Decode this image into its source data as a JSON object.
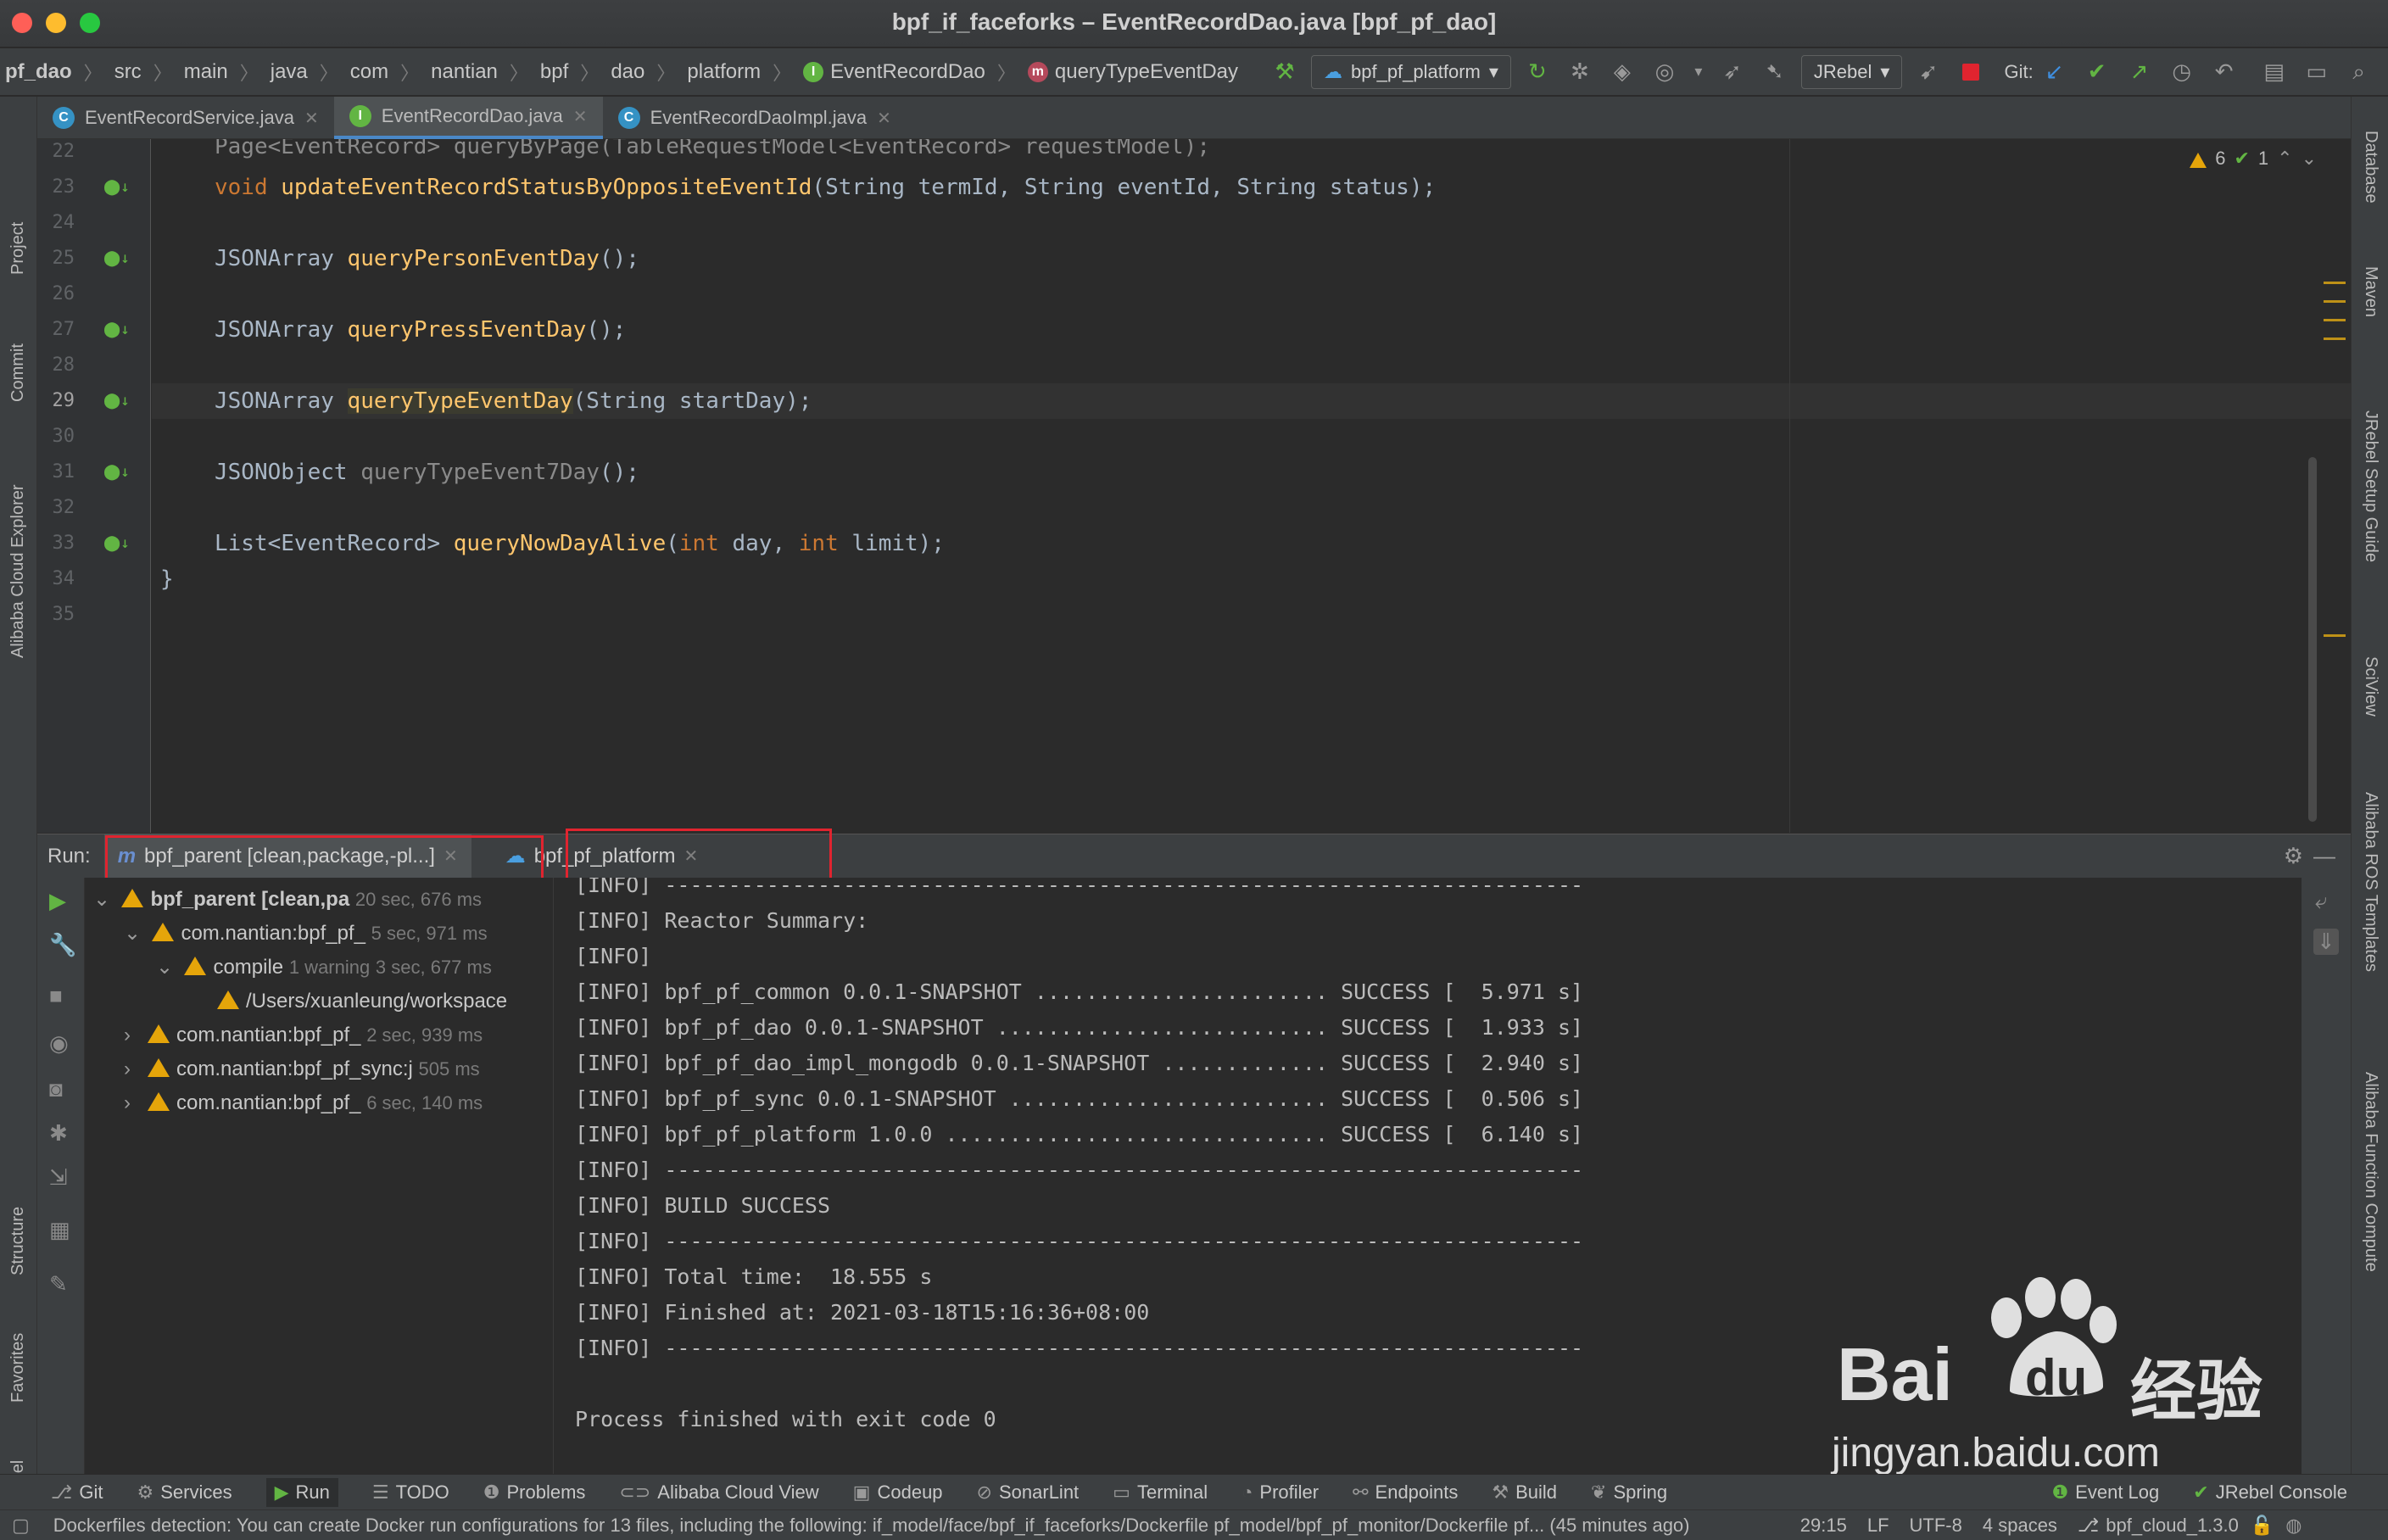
{
  "window": {
    "title": "bpf_if_faceforks – EventRecordDao.java [bpf_pf_dao]"
  },
  "breadcrumb": [
    "pf_dao",
    "src",
    "main",
    "java",
    "com",
    "nantian",
    "bpf",
    "dao",
    "platform",
    "EventRecordDao",
    "queryTypeEventDay"
  ],
  "toolbar": {
    "run_config": "bpf_pf_platform",
    "jrebel": "JRebel",
    "git_label": "Git:"
  },
  "editor_tabs": [
    {
      "label": "EventRecordService.java",
      "icon": "C",
      "color": "#3592c4"
    },
    {
      "label": "EventRecordDao.java",
      "icon": "I",
      "color": "#62b543"
    },
    {
      "label": "EventRecordDaoImpl.java",
      "icon": "C",
      "color": "#3592c4"
    }
  ],
  "editor": {
    "inspections": {
      "warnings": "6",
      "ok": "1"
    },
    "line_numbers": [
      "22",
      "23",
      "24",
      "25",
      "26",
      "27",
      "28",
      "29",
      "30",
      "31",
      "32",
      "33",
      "34",
      "35"
    ],
    "lines": {
      "l22": "Page<EventRecord> queryByPage(TableRequestModel<EventRecord> requestModel);",
      "l23_ret": "void",
      "l23_fn": "updateEventRecordStatusByOppositeEventId",
      "l23_p1": "(String termId, String eventId, String status);",
      "l25_ret": "JSONArray",
      "l25_fn": "queryPersonEventDay",
      "l25_rest": "();",
      "l27_ret": "JSONArray",
      "l27_fn": "queryPressEventDay",
      "l27_rest": "();",
      "l29_ret": "JSONArray",
      "l29_fn": "queryTypeEventDay",
      "l29_rest": "(String startDay);",
      "l31_ret": "JSONObject",
      "l31_fn": "queryTypeEvent7Day",
      "l31_rest": "();",
      "l33_ret": "List<EventRecord>",
      "l33_fn": "queryNowDayAlive",
      "l33_p1": "(",
      "l33_kw1": "int",
      "l33_p2": " day, ",
      "l33_kw2": "int",
      "l33_p3": " limit);",
      "l34": "}"
    }
  },
  "run_panel": {
    "label": "Run:",
    "tabs": [
      "bpf_parent [clean,package,-pl...]",
      "bpf_pf_platform"
    ],
    "tree": [
      {
        "label": "bpf_parent [clean,pa",
        "time": "20 sec, 676 ms"
      },
      {
        "label": "com.nantian:bpf_pf_",
        "time": "5 sec, 971 ms"
      },
      {
        "label": "compile",
        "note": "1 warning",
        "time": "3 sec, 677 ms"
      },
      {
        "label": "/Users/xuanleung/workspace",
        "time": ""
      },
      {
        "label": "com.nantian:bpf_pf_",
        "time": "2 sec, 939 ms"
      },
      {
        "label": "com.nantian:bpf_pf_sync:j",
        "time": "505 ms"
      },
      {
        "label": "com.nantian:bpf_pf_",
        "time": "6 sec, 140 ms"
      }
    ],
    "console": [
      "[INFO] ------------------------------------------------------------------------",
      "[INFO] Reactor Summary:",
      "[INFO]",
      "[INFO] bpf_pf_common 0.0.1-SNAPSHOT ....................... SUCCESS [  5.971 s]",
      "[INFO] bpf_pf_dao 0.0.1-SNAPSHOT .......................... SUCCESS [  1.933 s]",
      "[INFO] bpf_pf_dao_impl_mongodb 0.0.1-SNAPSHOT ............. SUCCESS [  2.940 s]",
      "[INFO] bpf_pf_sync 0.0.1-SNAPSHOT ......................... SUCCESS [  0.506 s]",
      "[INFO] bpf_pf_platform 1.0.0 .............................. SUCCESS [  6.140 s]",
      "[INFO] ------------------------------------------------------------------------",
      "[INFO] BUILD SUCCESS",
      "[INFO] ------------------------------------------------------------------------",
      "[INFO] Total time:  18.555 s",
      "[INFO] Finished at: 2021-03-18T15:16:36+08:00",
      "[INFO] ------------------------------------------------------------------------",
      "",
      "Process finished with exit code 0"
    ]
  },
  "left_tools": [
    "Project",
    "Commit",
    "Alibaba Cloud Explorer",
    "Structure",
    "Favorites",
    "JRebel"
  ],
  "right_tools": [
    "Database",
    "Maven",
    "JRebel Setup Guide",
    "SciView",
    "Alibaba ROS Templates",
    "Alibaba Function Compute"
  ],
  "bottom_tabs": [
    {
      "label": "Git",
      "icon": "⎇"
    },
    {
      "label": "Services",
      "icon": "⚙"
    },
    {
      "label": "Run",
      "icon": "▶"
    },
    {
      "label": "TODO",
      "icon": "☰"
    },
    {
      "label": "Problems",
      "icon": "❶"
    },
    {
      "label": "Alibaba Cloud View",
      "icon": "⊂⊃"
    },
    {
      "label": "Codeup",
      "icon": "▣"
    },
    {
      "label": "SonarLint",
      "icon": "⊘"
    },
    {
      "label": "Terminal",
      "icon": "▭"
    },
    {
      "label": "Profiler",
      "icon": "◔"
    },
    {
      "label": "Endpoints",
      "icon": "⚯"
    },
    {
      "label": "Build",
      "icon": "⚒"
    },
    {
      "label": "Spring",
      "icon": "❦"
    }
  ],
  "bottom_right_tabs": [
    {
      "label": "Event Log",
      "icon": "❶"
    },
    {
      "label": "JRebel Console",
      "icon": "✔"
    }
  ],
  "status": {
    "message": "Dockerfiles detection: You can create Docker run configurations for 13 files, including the following: if_model/face/bpf_if_faceforks/Dockerfile pf_model/bpf_pf_monitor/Dockerfile pf... (45 minutes ago)",
    "position": "29:15",
    "line_sep": "LF",
    "encoding": "UTF-8",
    "indent": "4 spaces",
    "branch": "bpf_cloud_1.3.0"
  },
  "watermark": {
    "brand": "Bai",
    "brand2": "du",
    "cn": "经验",
    "url": "jingyan.baidu.com"
  }
}
